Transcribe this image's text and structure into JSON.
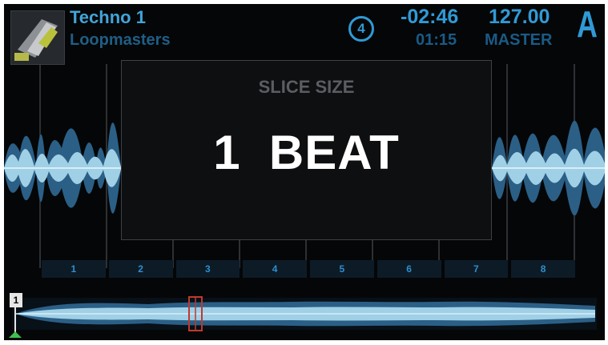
{
  "header": {
    "track_title": "Techno 1",
    "track_artist": "Loopmasters",
    "beat_counter": "4",
    "time_remaining": "-02:46",
    "time_elapsed": "01:15",
    "bpm": "127.00",
    "tempo_source": "MASTER",
    "deck_letter": "A"
  },
  "overlay": {
    "label": "SLICE SIZE",
    "value": "1  BEAT"
  },
  "slices": [
    "1",
    "2",
    "3",
    "4",
    "5",
    "6",
    "7",
    "8"
  ],
  "overview": {
    "cue_label": "1"
  },
  "colors": {
    "accent": "#2f9ad6",
    "waveform_light": "#9fd0e6",
    "waveform_dark": "#2b5f86",
    "playhead_marker": "#c0392b",
    "cue_marker": "#3fbf4f"
  }
}
